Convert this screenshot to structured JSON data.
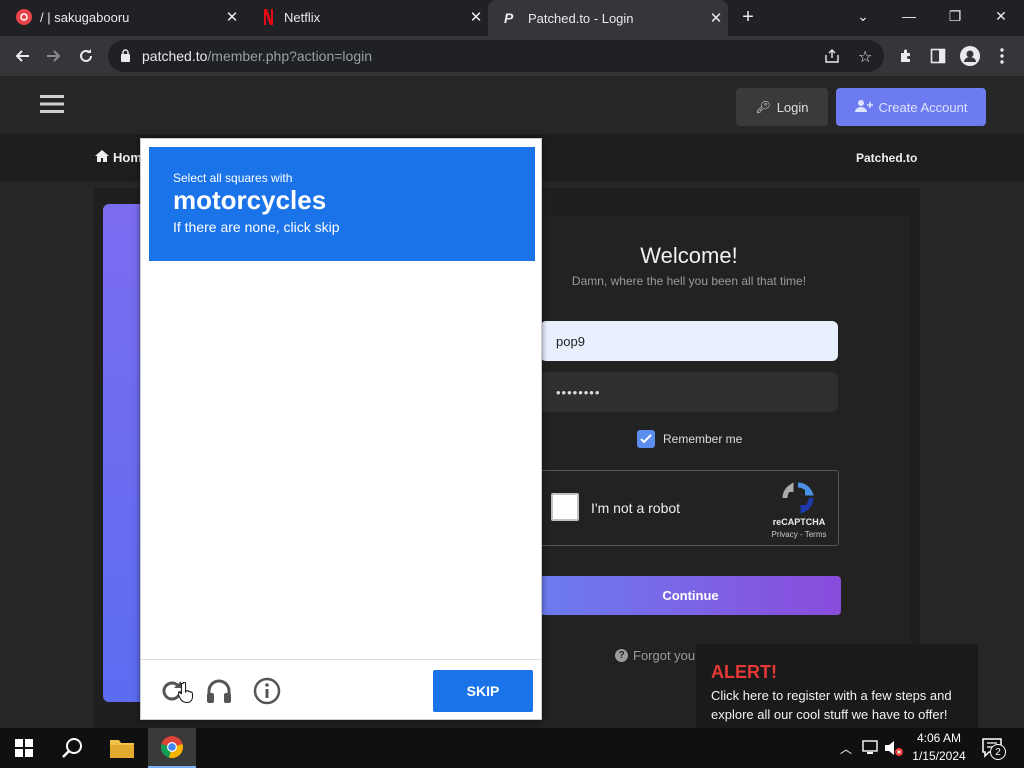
{
  "browser": {
    "tabs": [
      {
        "title": "/ | sakugabooru",
        "favicon": "sakugabooru-icon",
        "color": "#e8454a"
      },
      {
        "title": "Netflix",
        "favicon": "netflix-icon",
        "color": "#e50914"
      },
      {
        "title": "Patched.to - Login",
        "favicon": "patched-icon",
        "color": "#e8eaed"
      }
    ],
    "new_tab": "+",
    "window_controls": {
      "tab_search": "⌄",
      "minimize": "—",
      "restore": "❐",
      "close": "✕"
    },
    "url_host": "patched.to",
    "url_path": "/member.php?action=login"
  },
  "site": {
    "login_label": "Login",
    "create_account_label": "Create Account",
    "home_label": "Home",
    "brand_label": "Patched.to",
    "welcome_title": "Welcome!",
    "welcome_subtitle": "Damn, where the hell you been all that time!",
    "username_value": "pop9",
    "password_mask": "••••••••",
    "remember_label": "Remember me",
    "recaptcha": {
      "label": "I'm not a robot",
      "brand": "reCAPTCHA",
      "links": "Privacy - Terms"
    },
    "continue_label": "Continue",
    "forgot_label": "Forgot you",
    "accent": "#6c7cf0"
  },
  "captcha": {
    "instruction": "Select all squares with",
    "target": "motorcycles",
    "hint": "If there are none, click skip",
    "skip_label": "SKIP",
    "icons": [
      "reload-icon",
      "headphones-icon",
      "info-icon"
    ],
    "accent": "#1a73e8"
  },
  "alert": {
    "title": "ALERT!",
    "message": "Click here to register with a few steps and explore all our cool stuff we have to offer!"
  },
  "taskbar": {
    "time": "4:06 AM",
    "date": "1/15/2024",
    "notification_count": "2"
  }
}
